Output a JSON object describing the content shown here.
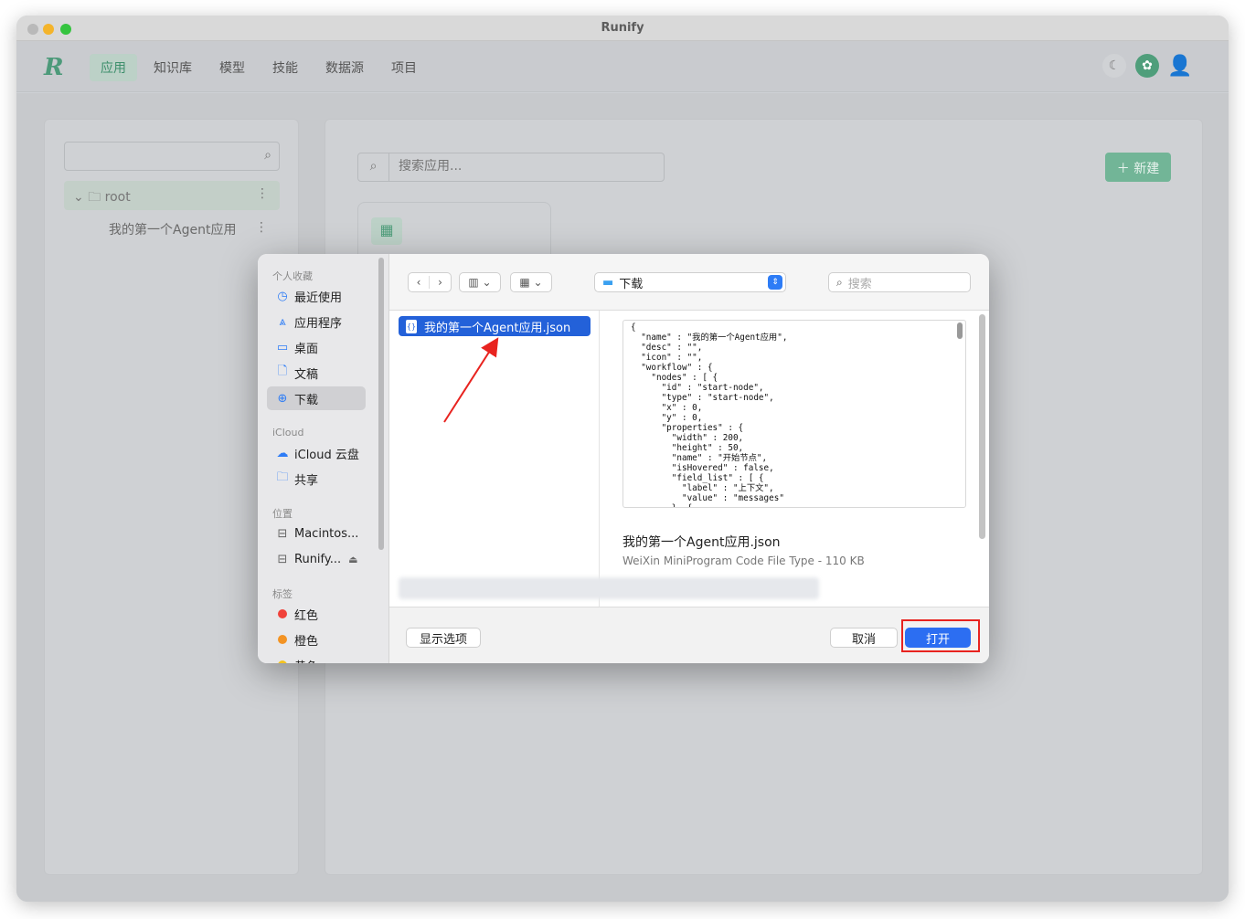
{
  "window": {
    "title": "Runify"
  },
  "header": {
    "logo": "R",
    "nav": [
      {
        "label": "应用",
        "active": true
      },
      {
        "label": "知识库",
        "active": false
      },
      {
        "label": "模型",
        "active": false
      },
      {
        "label": "技能",
        "active": false
      },
      {
        "label": "数据源",
        "active": false
      },
      {
        "label": "项目",
        "active": false
      }
    ],
    "icons": [
      "moon-icon",
      "brain-icon",
      "user-icon"
    ]
  },
  "tree": {
    "root_label": "root",
    "child_label": "我的第一个Agent应用"
  },
  "main": {
    "search_placeholder": "搜索应用...",
    "new_button": "新建"
  },
  "dialog": {
    "sidebar": {
      "favorites_title": "个人收藏",
      "favorites": [
        {
          "label": "最近使用",
          "icon": "clock-icon"
        },
        {
          "label": "应用程序",
          "icon": "apps-icon"
        },
        {
          "label": "桌面",
          "icon": "desktop-icon"
        },
        {
          "label": "文稿",
          "icon": "document-icon"
        },
        {
          "label": "下载",
          "icon": "download-icon",
          "selected": true
        }
      ],
      "icloud_title": "iCloud",
      "icloud": [
        {
          "label": "iCloud 云盘",
          "icon": "cloud-icon"
        },
        {
          "label": "共享",
          "icon": "shared-folder-icon"
        }
      ],
      "locations_title": "位置",
      "locations": [
        {
          "label": "Macintos...",
          "icon": "disk-icon"
        },
        {
          "label": "Runify...",
          "icon": "disk-icon",
          "eject": "⏏"
        }
      ],
      "tags_title": "标签",
      "tags": [
        {
          "label": "红色",
          "color": "#f0413a"
        },
        {
          "label": "橙色",
          "color": "#f39323"
        },
        {
          "label": "黄色",
          "color": "#f4c31f"
        }
      ]
    },
    "toolbar": {
      "path": "下载",
      "search_placeholder": "搜索"
    },
    "file": {
      "name": "我的第一个Agent应用.json"
    },
    "preview": {
      "code": "{\n  \"name\" : \"我的第一个Agent应用\",\n  \"desc\" : \"\",\n  \"icon\" : \"\",\n  \"workflow\" : {\n    \"nodes\" : [ {\n      \"id\" : \"start-node\",\n      \"type\" : \"start-node\",\n      \"x\" : 0,\n      \"y\" : 0,\n      \"properties\" : {\n        \"width\" : 200,\n        \"height\" : 50,\n        \"name\" : \"开始节点\",\n        \"isHovered\" : false,\n        \"field_list\" : [ {\n          \"label\" : \"上下文\",\n          \"value\" : \"messages\"\n        }, {",
      "name": "我的第一个Agent应用.json",
      "type": "WeiXin MiniProgram Code File Type - 110 KB"
    },
    "footer": {
      "options": "显示选项",
      "cancel": "取消",
      "open": "打开"
    }
  },
  "colors": {
    "accent": "#4f9e7b",
    "dialog_blue": "#2c6ef2",
    "highlight": "#e8231f"
  }
}
